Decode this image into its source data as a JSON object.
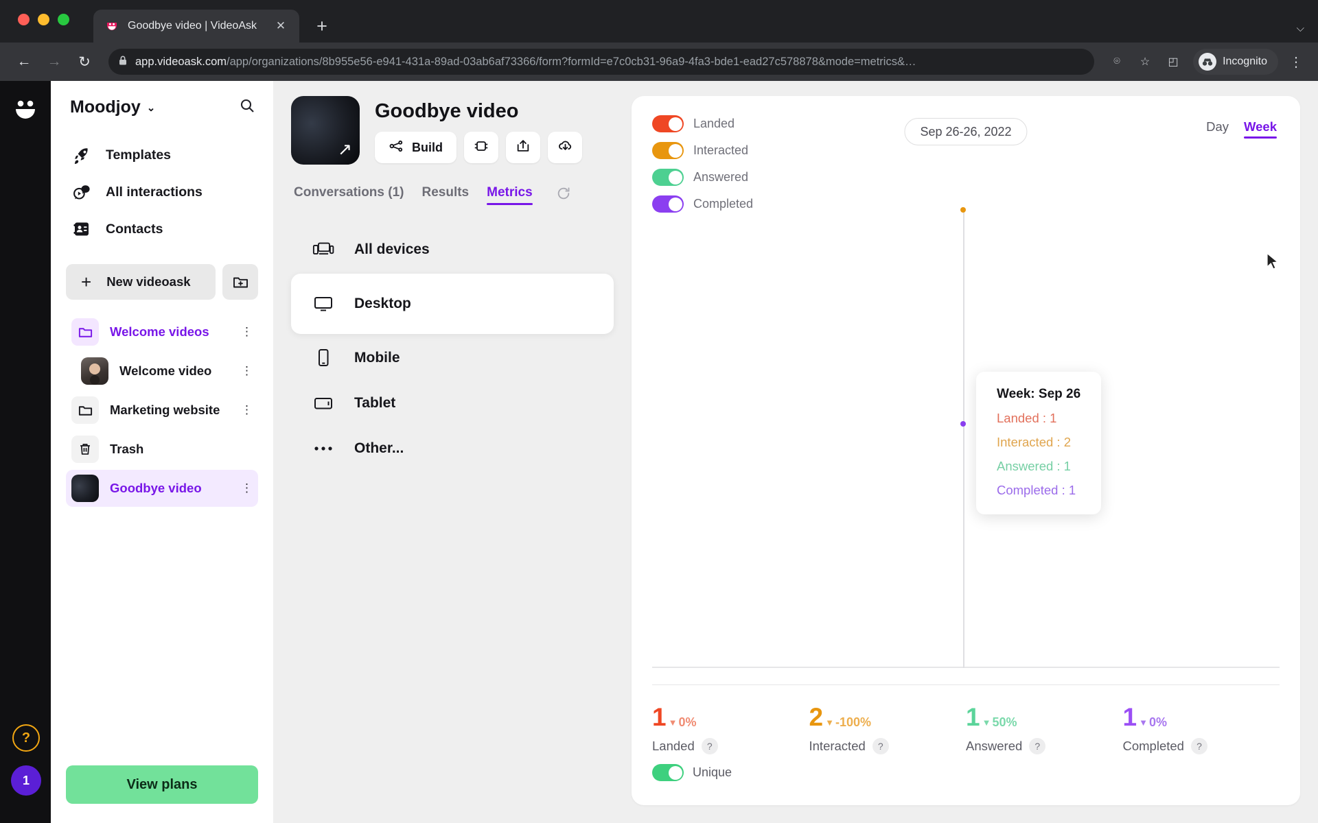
{
  "browser": {
    "tab": {
      "title": "Goodbye video | VideoAsk",
      "close_label": "✕",
      "favicon_name": "videoask-favicon"
    },
    "new_tab_label": "+",
    "tabstrip_menu_label": "⌵",
    "nav": {
      "back": "←",
      "forward": "→",
      "reload": "↻"
    },
    "url": {
      "lock_name": "lock-icon",
      "domain": "app.videoask.com",
      "path": "/app/organizations/8b955e56-e941-431a-89ad-03ab6af73366/form?formId=e7c0cb31-96a9-4fa3-bde1-ead27c578878&mode=metrics&…"
    },
    "omni": {
      "hide_label": "⌾",
      "star_label": "☆",
      "sidepanel_label": "◰"
    },
    "profile": {
      "label": "Incognito"
    },
    "menu_label": "⋮"
  },
  "rail": {
    "logo_name": "videoask-logo",
    "help_label": "?",
    "badge_count": "1"
  },
  "sidebar": {
    "org": {
      "name": "Moodjoy",
      "chevron": "⌄"
    },
    "search_name": "search-icon",
    "nav": [
      {
        "label": "Templates",
        "icon": "rocket-icon"
      },
      {
        "label": "All interactions",
        "icon": "chat-play-icon"
      },
      {
        "label": "Contacts",
        "icon": "contacts-icon"
      }
    ],
    "new_videoask": {
      "label": "New videoask",
      "plus": "+"
    },
    "new_folder_name": "new-folder-icon",
    "tree": [
      {
        "label": "Welcome videos",
        "kind": "folder-open",
        "purple": true,
        "indent": false,
        "menu": "⋮"
      },
      {
        "label": "Welcome video",
        "kind": "thumb-person",
        "purple": false,
        "indent": true,
        "menu": "⋮"
      },
      {
        "label": "Marketing website",
        "kind": "folder-plain",
        "purple": false,
        "indent": false,
        "menu": "⋮"
      },
      {
        "label": "Trash",
        "kind": "trash",
        "purple": false,
        "indent": false,
        "menu": ""
      },
      {
        "label": "Goodbye video",
        "kind": "thumb-moon",
        "purple": true,
        "indent": false,
        "menu": "⋮",
        "active": true
      }
    ],
    "view_plans": "View plans"
  },
  "form": {
    "title": "Goodbye video",
    "cover_name": "goodbye-video-cover",
    "buttons": [
      {
        "label": "Build",
        "icon": "flow-nodes-icon",
        "kind": "wide"
      },
      {
        "label": "",
        "icon": "embed-icon",
        "kind": "square"
      },
      {
        "label": "",
        "icon": "share-icon",
        "kind": "square"
      },
      {
        "label": "",
        "icon": "download-icon",
        "kind": "square"
      }
    ],
    "tabs": [
      {
        "label": "Conversations (1)",
        "active": false
      },
      {
        "label": "Results",
        "active": false
      },
      {
        "label": "Metrics",
        "active": true
      }
    ],
    "refresh_name": "refresh-icon",
    "devices": [
      {
        "label": "All devices",
        "icon": "all-devices-icon",
        "selected": false
      },
      {
        "label": "Desktop",
        "icon": "desktop-icon",
        "selected": true
      },
      {
        "label": "Mobile",
        "icon": "mobile-icon",
        "selected": false
      },
      {
        "label": "Tablet",
        "icon": "tablet-icon",
        "selected": false
      },
      {
        "label": "Other...",
        "icon": "ellipsis-icon",
        "selected": false
      }
    ]
  },
  "metrics": {
    "date_range": "Sep 26-26, 2022",
    "granularity": [
      {
        "label": "Day",
        "active": false
      },
      {
        "label": "Week",
        "active": true
      }
    ],
    "legend": [
      {
        "label": "Landed",
        "color": "#ef4724",
        "on": true
      },
      {
        "label": "Interacted",
        "color": "#e8960f",
        "on": true
      },
      {
        "label": "Answered",
        "color": "#4dd091",
        "on": true
      },
      {
        "label": "Completed",
        "color": "#8b3ff0",
        "on": true
      }
    ],
    "tooltip": {
      "title": "Week: Sep 26",
      "rows": [
        {
          "label": "Landed : 1",
          "color": "#e2705b"
        },
        {
          "label": "Interacted : 2",
          "color": "#e0a54e"
        },
        {
          "label": "Answered : 1",
          "color": "#76cfa4"
        },
        {
          "label": "Completed : 1",
          "color": "#9b6bea"
        }
      ]
    },
    "stats": [
      {
        "label": "Landed",
        "value": "1",
        "delta": "0%",
        "trend": "▼",
        "color": "#ef4724",
        "help": "?",
        "unique_toggle": {
          "label": "Unique",
          "on": true
        }
      },
      {
        "label": "Interacted",
        "value": "2",
        "delta": "-100%",
        "trend": "▼",
        "color": "#e8960f",
        "help": "?"
      },
      {
        "label": "Answered",
        "value": "1",
        "delta": "50%",
        "trend": "▼",
        "color": "#4dd091",
        "help": "?"
      },
      {
        "label": "Completed",
        "value": "1",
        "delta": "0%",
        "trend": "▼",
        "color": "#8b3ff0",
        "help": "?"
      }
    ]
  },
  "chart_data": {
    "type": "line",
    "title": "",
    "xlabel": "",
    "ylabel": "",
    "categories": [
      "Sep 26"
    ],
    "series": [
      {
        "name": "Landed",
        "color": "#ef4724",
        "values": [
          1
        ]
      },
      {
        "name": "Interacted",
        "color": "#e8960f",
        "values": [
          2
        ]
      },
      {
        "name": "Answered",
        "color": "#4dd091",
        "values": [
          1
        ]
      },
      {
        "name": "Completed",
        "color": "#8b3ff0",
        "values": [
          1
        ]
      }
    ],
    "grid": false,
    "legend_position": "top-left",
    "ylim": [
      0,
      2
    ],
    "hovered_point": {
      "x": "Sep 26",
      "landed": 1,
      "interacted": 2,
      "answered": 1,
      "completed": 1
    }
  }
}
